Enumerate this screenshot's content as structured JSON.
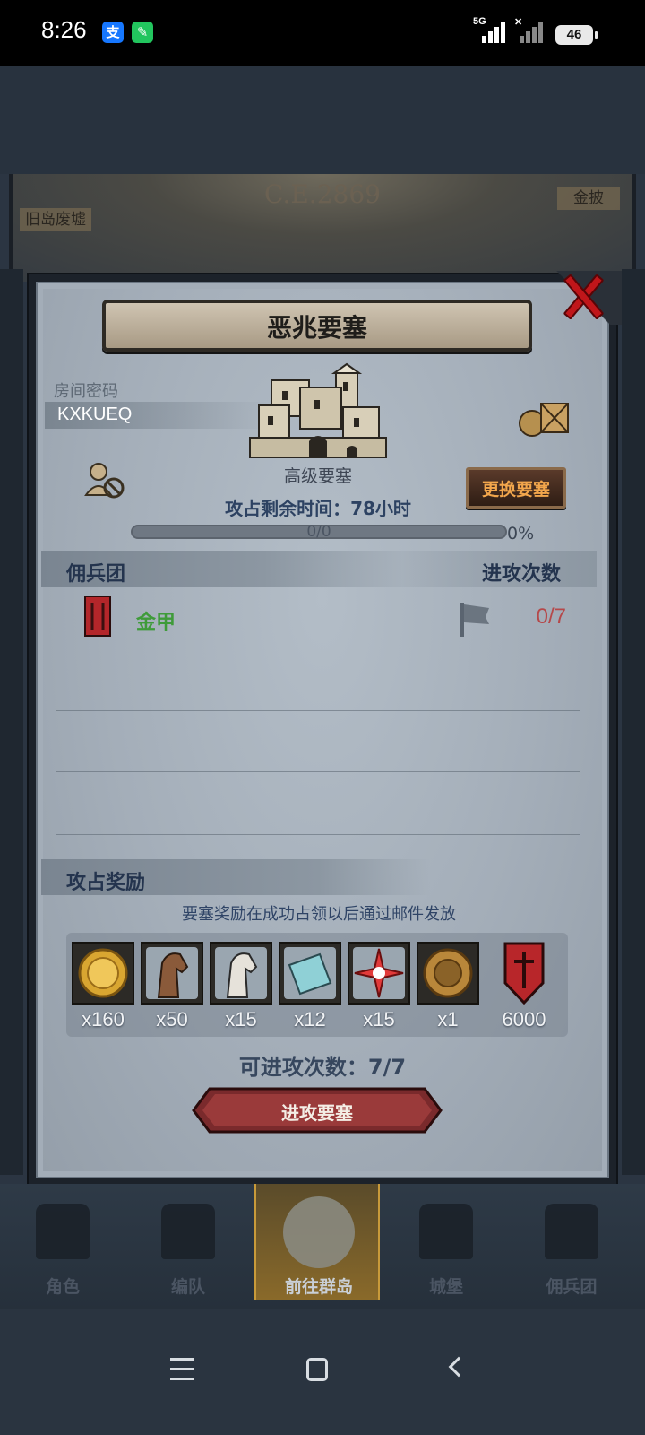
{
  "status_bar": {
    "time": "8:26",
    "app_icon_a": "支",
    "app_icon_b": "✎",
    "network": "5G",
    "wifi_mark": "✕",
    "battery": "46"
  },
  "map": {
    "era": "C.E.2869",
    "label_left": "旧岛废墟",
    "label_right": "金披"
  },
  "dialog": {
    "title": "恶兆要塞",
    "room_label": "房间密码",
    "room_code": "KXKUEQ",
    "fortress_type": "高级要塞",
    "change_button": "更换要塞",
    "time_remaining": "攻占剩余时间：78小时",
    "progress_count": "0/0",
    "progress_percent": "0%",
    "progress_fraction": 0,
    "mercenary_header": "佣兵团",
    "attack_count_header": "进攻次数",
    "mercenaries": [
      {
        "name": "金甲",
        "attacks": "0/7"
      }
    ],
    "reward_header": "攻占奖励",
    "reward_note": "要塞奖励在成功占领以后通过邮件发放",
    "rewards": [
      {
        "icon": "gold-coin-icon",
        "qty": "x160"
      },
      {
        "icon": "brown-horse-icon",
        "qty": "x50"
      },
      {
        "icon": "white-horse-icon",
        "qty": "x15"
      },
      {
        "icon": "cloth-scroll-icon",
        "qty": "x12"
      },
      {
        "icon": "red-star-icon",
        "qty": "x15"
      },
      {
        "icon": "knight-medal-icon",
        "qty": "x1"
      },
      {
        "icon": "red-shield-icon",
        "qty": "6000"
      }
    ],
    "available_attacks": "可进攻次数：7/7",
    "attack_button": "进攻要塞"
  },
  "bottom_nav": [
    {
      "label": "角色",
      "active": false
    },
    {
      "label": "编队",
      "active": false
    },
    {
      "label": "前往群岛",
      "active": true
    },
    {
      "label": "城堡",
      "active": false
    },
    {
      "label": "佣兵团",
      "active": false
    }
  ],
  "colors": {
    "accent_gold": "#f2a64c",
    "merc_green": "#3f9b3a",
    "ratio_red": "#b5484a",
    "close_red": "#c0161a"
  }
}
